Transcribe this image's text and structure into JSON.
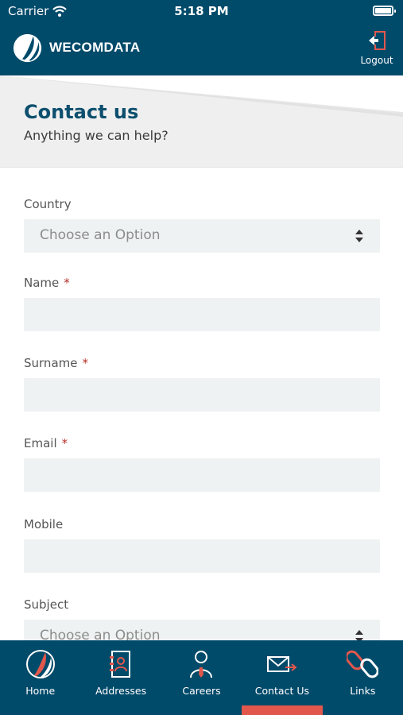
{
  "status": {
    "carrier": "Carrier",
    "time": "5:18 PM"
  },
  "header": {
    "brand": "WECOMDATA",
    "logout_label": "Logout"
  },
  "hero": {
    "title": "Contact us",
    "subtitle": "Anything we can help?"
  },
  "form": {
    "country": {
      "label": "Country",
      "value": "Choose an Option"
    },
    "name": {
      "label": "Name",
      "required_mark": "*",
      "value": ""
    },
    "surname": {
      "label": "Surname",
      "required_mark": "*",
      "value": ""
    },
    "email": {
      "label": "Email",
      "required_mark": "*",
      "value": ""
    },
    "mobile": {
      "label": "Mobile",
      "value": ""
    },
    "subject": {
      "label": "Subject",
      "value": "Choose an Option"
    }
  },
  "tabs": [
    {
      "label": "Home",
      "icon": "home-logo-icon"
    },
    {
      "label": "Addresses",
      "icon": "address-book-icon"
    },
    {
      "label": "Careers",
      "icon": "person-tie-icon"
    },
    {
      "label": "Contact Us",
      "icon": "envelope-arrow-icon",
      "active": true
    },
    {
      "label": "Links",
      "icon": "link-chain-icon"
    }
  ],
  "colors": {
    "primary": "#004a6a",
    "accent": "#e2574c",
    "field_bg": "#eff2f2",
    "title": "#0d4f6e",
    "required": "#b5302a"
  }
}
